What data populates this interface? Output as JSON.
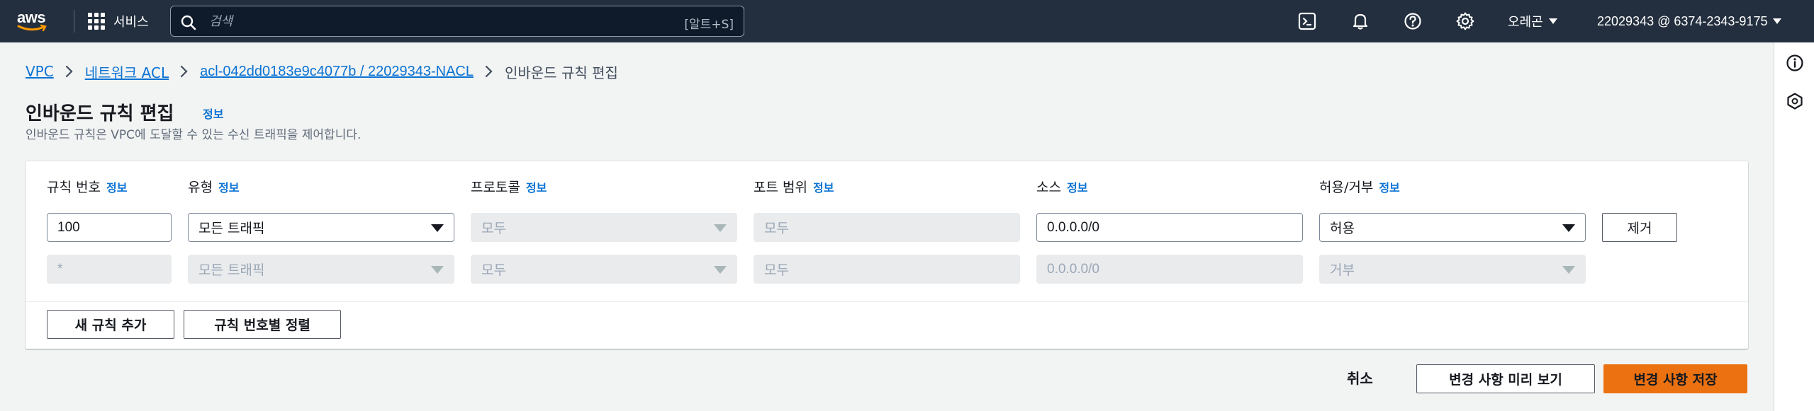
{
  "nav": {
    "logo_text": "aws",
    "services_label": "서비스",
    "search_placeholder": "검색",
    "search_shortcut": "[알트+S]",
    "region": "오레곤",
    "account": "22029343 @ 6374-2343-9175"
  },
  "breadcrumb": {
    "items": [
      "VPC",
      "네트워크 ACL",
      "acl-042dd0183e9c4077b / 22029343-NACL"
    ],
    "current": "인바운드 규칙 편집"
  },
  "header": {
    "title": "인바운드 규칙 편집",
    "info": "정보",
    "description": "인바운드 규칙은 VPC에 도달할 수 있는 수신 트래픽을 제어합니다."
  },
  "table": {
    "info_label": "정보",
    "columns": [
      "규칙 번호",
      "유형",
      "프로토콜",
      "포트 범위",
      "소스",
      "허용/거부"
    ],
    "rows": [
      {
        "rule_number": "100",
        "type": "모든 트래픽",
        "protocol": "모두",
        "port_range": "모두",
        "source": "0.0.0.0/0",
        "action": "허용",
        "remove_label": "제거"
      },
      {
        "rule_number": "*",
        "type": "모든 트래픽",
        "protocol": "모두",
        "port_range": "모두",
        "source": "0.0.0.0/0",
        "action": "거부"
      }
    ],
    "add_rule_label": "새 규칙 추가",
    "sort_label": "규칙 번호별 정렬"
  },
  "footer": {
    "cancel": "취소",
    "preview": "변경 사항 미리 보기",
    "save": "변경 사항 저장"
  },
  "colors": {
    "nav_bg": "#232f3e",
    "link": "#0972d3",
    "primary": "#ec7211",
    "page_bg": "#f2f3f3"
  }
}
